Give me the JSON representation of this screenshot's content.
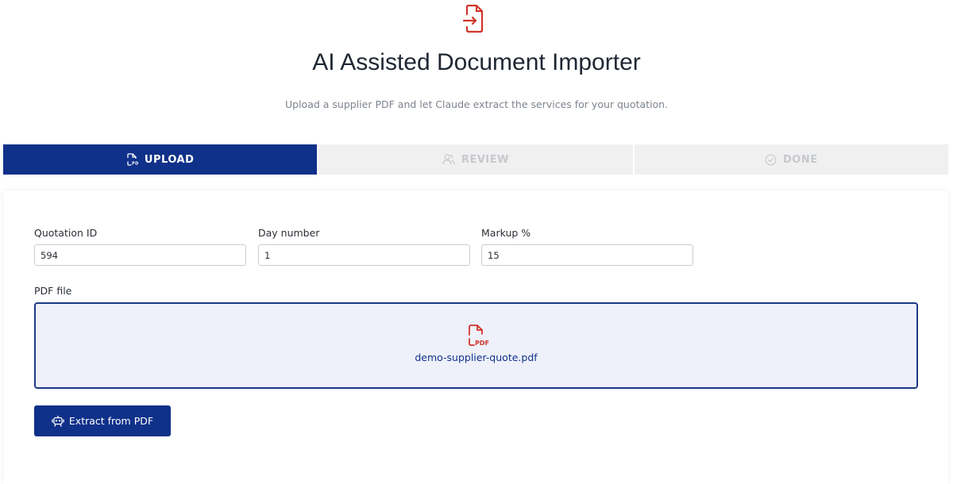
{
  "header": {
    "icon": "file-import-icon",
    "title": "AI Assisted Document Importer",
    "subtitle": "Upload a supplier PDF and let Claude extract the services for your quotation."
  },
  "steps": [
    {
      "label": "UPLOAD",
      "icon": "pdf-file-icon",
      "active": true
    },
    {
      "label": "REVIEW",
      "icon": "users-icon",
      "active": false
    },
    {
      "label": "DONE",
      "icon": "check-circle-icon",
      "active": false
    }
  ],
  "form": {
    "quotation_id": {
      "label": "Quotation ID",
      "value": "594"
    },
    "day_number": {
      "label": "Day number",
      "value": "1"
    },
    "markup": {
      "label": "Markup %",
      "value": "15"
    },
    "pdf": {
      "label": "PDF file",
      "icon": "pdf-file-icon",
      "icon_text": "PDF",
      "file_name": "demo-supplier-quote.pdf"
    },
    "extract_button": {
      "label": "Extract from PDF",
      "icon": "robot-icon"
    }
  },
  "colors": {
    "primary": "#10318a",
    "accent_red": "#d0362c",
    "dropzone_bg": "#eef1fa",
    "inactive_step_bg": "#f0f0f0",
    "inactive_step_text": "#c6c9cd"
  }
}
